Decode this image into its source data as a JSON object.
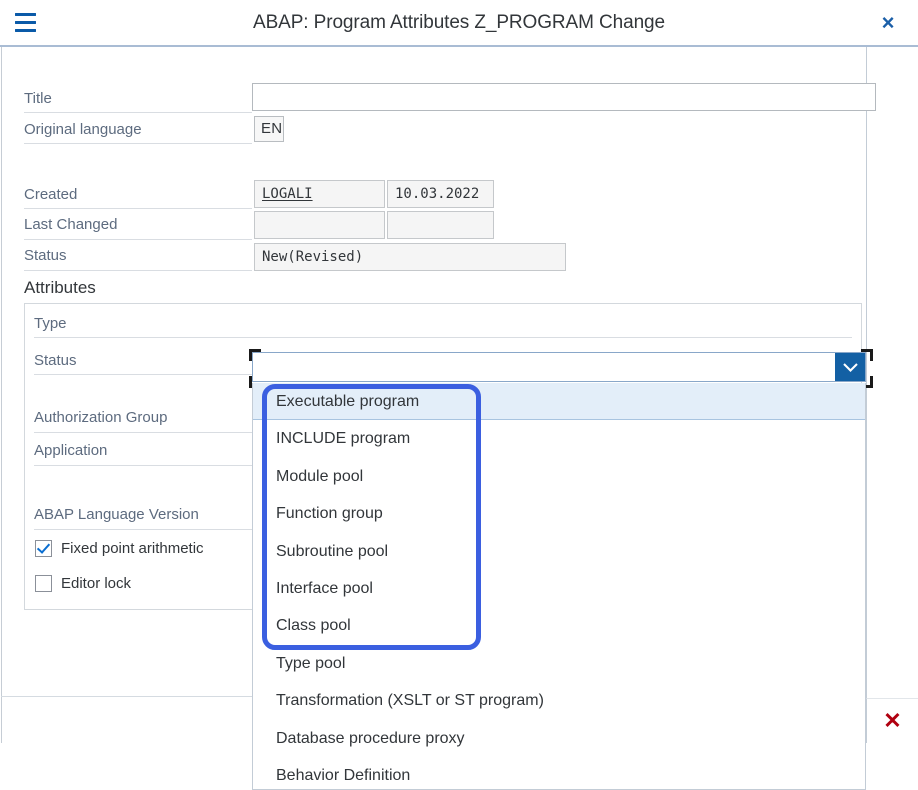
{
  "window": {
    "title": "ABAP: Program Attributes Z_PROGRAM Change",
    "menu_icon": "hamburger-menu-icon",
    "close_icon": "×"
  },
  "form": {
    "title_label": "Title",
    "title_value": "",
    "title_placeholder": "",
    "original_language_label": "Original language",
    "original_language_value": "EN",
    "created_label": "Created",
    "created_user": "LOGALI",
    "created_date": "10.03.2022",
    "last_changed_label": "Last Changed",
    "last_changed_user": "",
    "last_changed_date": "",
    "status_label": "Status",
    "status_value": "New(Revised)"
  },
  "attributes": {
    "section_title": "Attributes",
    "type_label": "Type",
    "type_value": "",
    "status_label": "Status",
    "status_value": "",
    "authorization_group_label": "Authorization Group",
    "authorization_group_value": "",
    "application_label": "Application",
    "application_value": "",
    "abap_language_version_label": "ABAP Language Version",
    "abap_language_version_value": "",
    "checkboxes": [
      {
        "label": "Fixed point arithmetic",
        "checked": true
      },
      {
        "label": "Editor lock",
        "checked": false
      }
    ]
  },
  "type_dropdown": {
    "expanded": true,
    "chevron_icon": "chevron-down-icon",
    "selected_index": 0,
    "options": [
      "Executable program",
      "INCLUDE program",
      "Module pool",
      "Function group",
      "Subroutine pool",
      "Interface pool",
      "Class pool",
      "Type pool",
      "Transformation (XSLT or ST program)",
      "Database procedure proxy",
      "Behavior Definition"
    ]
  },
  "footer": {
    "cancel_icon": "✕"
  },
  "colors": {
    "accent_blue": "#0a5aa8",
    "dropdown_button": "#1360a4",
    "annotation_blue": "#3b5fe0",
    "selected_row": "#e3eef9",
    "cancel_red": "#b00010",
    "label_gray": "#5d6b7f"
  }
}
